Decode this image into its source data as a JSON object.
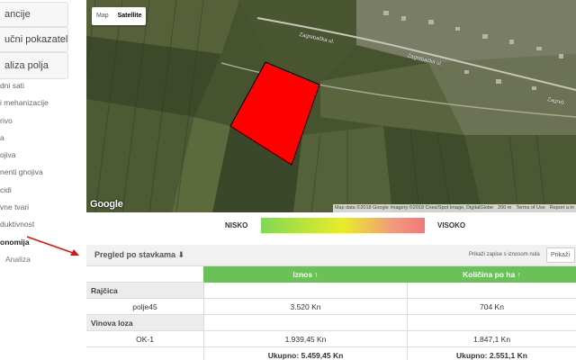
{
  "sidebar": {
    "sections": [
      "ancije",
      "učni pokazatelji",
      "aliza polja"
    ],
    "items": [
      {
        "label": "dni sati"
      },
      {
        "label": "i mehanizacije"
      },
      {
        "label": "rivo"
      },
      {
        "label": "a"
      },
      {
        "label": "ojiva"
      },
      {
        "label": "nenti gnojiva"
      },
      {
        "label": "cidi"
      },
      {
        "label": "vne tvari"
      },
      {
        "label": "duktivnost"
      },
      {
        "label": "onomija"
      },
      {
        "label": "Analiza"
      }
    ]
  },
  "map": {
    "type_buttons": {
      "map": "Map",
      "satellite": "Satellite"
    },
    "streets": [
      "Zagrebačka ul.",
      "Zagrebačka ul.",
      "Zagreb"
    ],
    "logo": "Google",
    "attribution": [
      "Map data ©2018 Google Imagery ©2018 Cnes/Spot Image, DigitalGlobe",
      "200 m",
      "Terms of Use",
      "Report a m"
    ],
    "field_color": "#ff0000"
  },
  "legend": {
    "low": "NISKO",
    "high": "VISOKO"
  },
  "panel": {
    "title": "Pregled po stavkama ⬇",
    "option_label": "Prikaži zapise s iznosom nula",
    "option_button": "Prikaži"
  },
  "table": {
    "columns": [
      "Iznos ↑",
      "Količina po ha ↑"
    ],
    "rows": [
      {
        "kind": "group",
        "name": "Rajčica"
      },
      {
        "kind": "item",
        "name": "polje45",
        "iznos": "3.520 Kn",
        "kolicina": "704 Kn"
      },
      {
        "kind": "group",
        "name": "Vinova loza"
      },
      {
        "kind": "item",
        "name": "OK-1",
        "iznos": "1.939,45 Kn",
        "kolicina": "1.847,1 Kn"
      },
      {
        "kind": "total",
        "name": "",
        "iznos": "Ukupno: 5.459,45 Kn",
        "kolicina": "Ukupno: 2.551,1 Kn"
      }
    ]
  }
}
